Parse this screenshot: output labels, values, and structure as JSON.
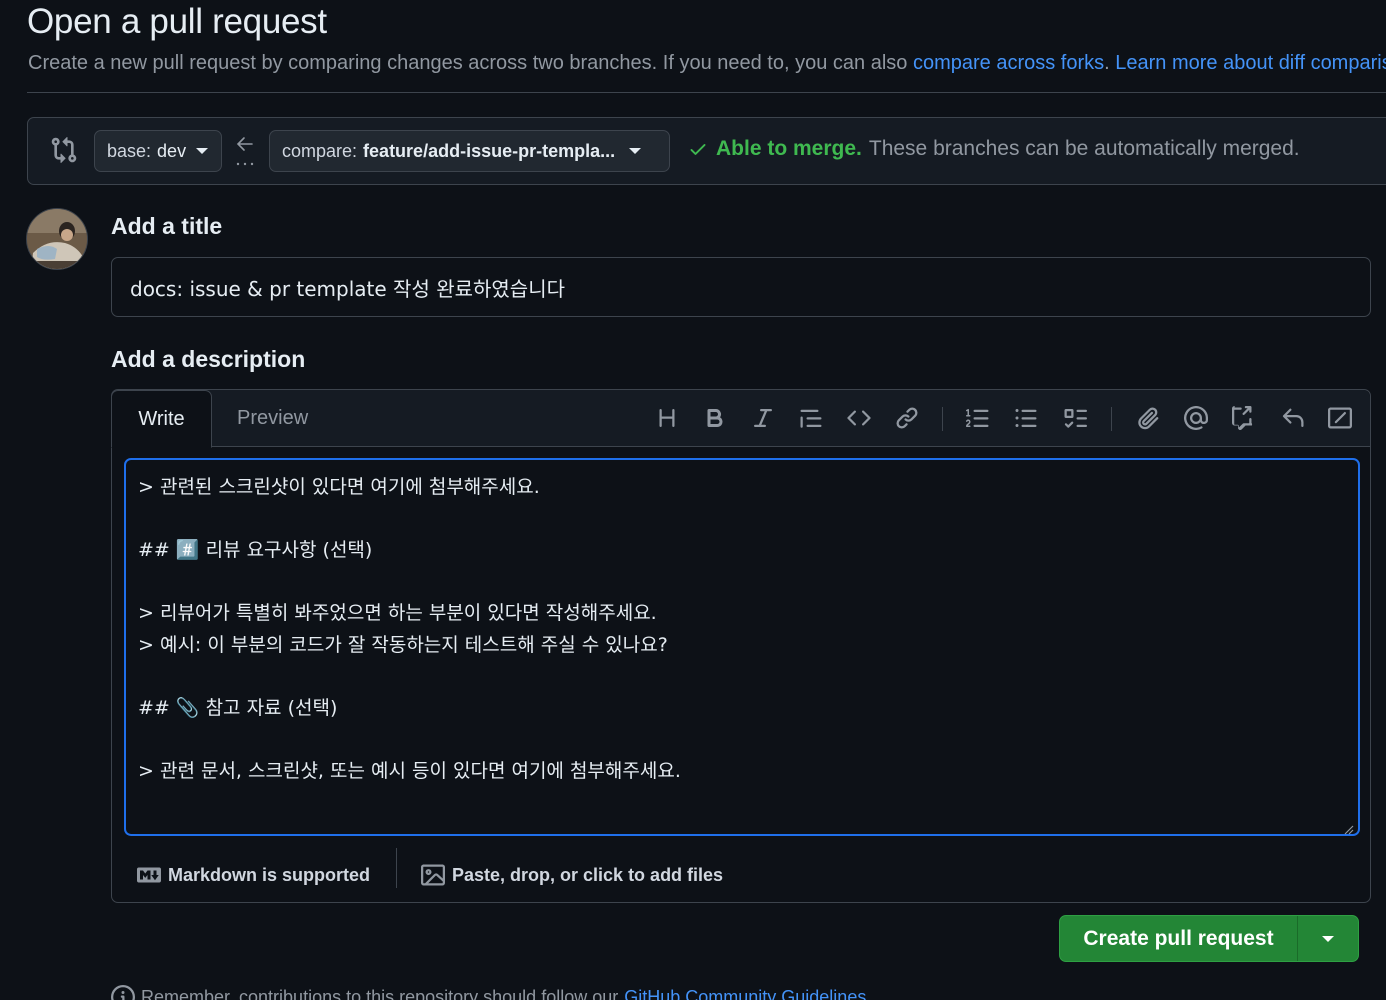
{
  "header": {
    "title": "Open a pull request",
    "subtitle_text": "Create a new pull request by comparing changes across two branches. If you need to, you can also ",
    "compare_forks_link": "compare across forks",
    "subtitle_period": ". ",
    "learn_more_link": "Learn more about diff comparisons"
  },
  "range": {
    "base_prefix": "base:",
    "base_branch": "dev",
    "compare_prefix": "compare:",
    "compare_branch": "feature/add-issue-pr-templa...",
    "merge_ok": "Able to merge.",
    "merge_text": "These branches can be automatically merged.",
    "merge_color": "#3fb950"
  },
  "form": {
    "title_label": "Add a title",
    "title_value": "docs: issue & pr template 작성 완료하였습니다",
    "description_label": "Add a description",
    "tabs": [
      "Write",
      "Preview"
    ],
    "toolbar_icons": [
      "heading-icon",
      "bold-icon",
      "italic-icon",
      "quote-icon",
      "code-icon",
      "link-icon",
      "ordered-list-icon",
      "unordered-list-icon",
      "task-list-icon",
      "attach-icon",
      "mention-icon",
      "reference-icon",
      "reply-icon",
      "slash-command-icon"
    ],
    "body_lines": [
      "> 관련된 스크린샷이 있다면 여기에 첨부해주세요.",
      "",
      "## #️⃣ 리뷰 요구사항 (선택)",
      "",
      "> 리뷰어가 특별히 봐주었으면 하는 부분이 있다면 작성해주세요.",
      "> 예시: 이 부분의 코드가 잘 작동하는지 테스트해 주실 수 있나요?",
      "",
      "## 📎 참고 자료 (선택)",
      "",
      "> 관련 문서, 스크린샷, 또는 예시 등이 있다면 여기에 첨부해주세요."
    ],
    "markdown_note": "Markdown is supported",
    "attach_note": "Paste, drop, or click to add files"
  },
  "actions": {
    "create_label": "Create pull request",
    "accent": "#238636"
  },
  "footer": {
    "remember_text": "Remember, contributions to this repository should follow our",
    "guidelines_link": "GitHub Community Guidelines"
  }
}
